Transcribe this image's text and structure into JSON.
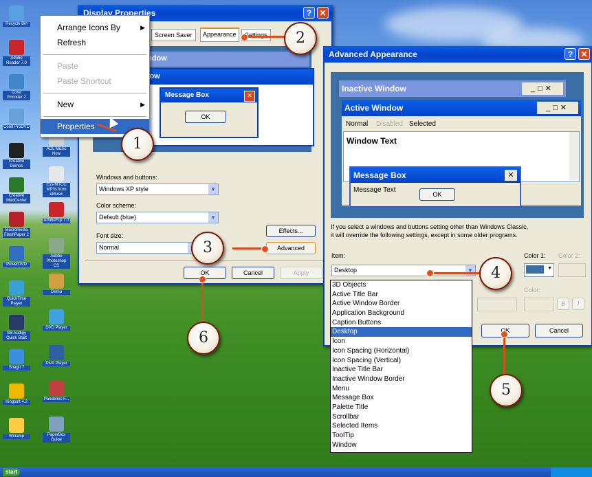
{
  "desktop": {
    "icons": [
      {
        "label": "Recycle Bin"
      },
      {
        "label": "Adobe Reader 7.0"
      },
      {
        "label": "Corel Encoder 2"
      },
      {
        "label": "Corel ProDVD"
      },
      {
        "label": "Creative Demos"
      },
      {
        "label": "Creative MedCenter"
      },
      {
        "label": "Macromedia FlashPaper 2"
      },
      {
        "label": "PowerDVD"
      },
      {
        "label": "QuickTime Player"
      },
      {
        "label": "SB Audigy Quick Start"
      },
      {
        "label": "SnagIt 7"
      },
      {
        "label": "Kingsoft 4.2"
      },
      {
        "label": "Winamp"
      },
      {
        "label": "AOL Music Now"
      },
      {
        "label": "Ess-MTCC MP3s from eMusic"
      },
      {
        "label": "AdobeFuji 7.0"
      },
      {
        "label": "Adobe Photoshop CS"
      },
      {
        "label": "Demo"
      },
      {
        "label": "DVD Player"
      },
      {
        "label": "DivX Player"
      },
      {
        "label": "Pandemic F..."
      },
      {
        "label": "PaperBox Guide"
      }
    ]
  },
  "context_menu": {
    "items": [
      {
        "label": "Arrange Icons By",
        "has_submenu": true
      },
      {
        "label": "Refresh"
      },
      {
        "label": "Paste",
        "disabled": true
      },
      {
        "label": "Paste Shortcut",
        "disabled": true
      },
      {
        "label": "New",
        "has_submenu": true
      },
      {
        "label": "Properties",
        "highlighted": true
      }
    ]
  },
  "display_properties": {
    "title": "Display Properties",
    "tabs": [
      "Screen Saver",
      "Appearance",
      "Settings"
    ],
    "active_tab": "Appearance",
    "preview": {
      "inactive_title": "indow",
      "active_title": "ndow",
      "message_box_title": "Message Box",
      "ok_label": "OK"
    },
    "windows_and_buttons_label": "Windows and buttons:",
    "windows_and_buttons_value": "Windows XP style",
    "color_scheme_label": "Color scheme:",
    "color_scheme_value": "Default (blue)",
    "font_size_label": "Font size:",
    "font_size_value": "Normal",
    "effects_label": "Effects...",
    "advanced_label": "Advanced",
    "ok_label": "OK",
    "cancel_label": "Cancel",
    "apply_label": "Apply"
  },
  "advanced_appearance": {
    "title": "Advanced Appearance",
    "preview": {
      "inactive_window": "Inactive Window",
      "active_window": "Active Window",
      "menu_normal": "Normal",
      "menu_disabled": "Disabled",
      "menu_selected": "Selected",
      "window_text": "Window Text",
      "message_box": "Message Box",
      "message_text": "Message Text",
      "ok_label": "OK"
    },
    "info_text_1": "If you select a windows and buttons setting other than Windows Classic,",
    "info_text_2": "it will override the following settings, except in some older programs.",
    "item_label": "Item:",
    "item_value": "Desktop",
    "color1_label": "Color 1:",
    "color2_label": "Color 2:",
    "color_label": "Color:",
    "bold_label": "B",
    "italic_label": "I",
    "ok_label": "OK",
    "cancel_label": "Cancel",
    "item_options": [
      "3D Objects",
      "Active Title Bar",
      "Active Window Border",
      "Application Background",
      "Caption Buttons",
      "Desktop",
      "Icon",
      "Icon Spacing (Horizontal)",
      "Icon Spacing (Vertical)",
      "Inactive Title Bar",
      "Inactive Window Border",
      "Menu",
      "Message Box",
      "Palette Title",
      "Scrollbar",
      "Selected Items",
      "ToolTip",
      "Window"
    ],
    "selected_option": "Desktop"
  },
  "callouts": [
    "1",
    "2",
    "3",
    "4",
    "5",
    "6"
  ],
  "taskbar": {
    "start_label": "start"
  },
  "colors": {
    "xp_blue": "#0542c8",
    "callout_line": "#d84f1f",
    "selection": "#316ac5"
  }
}
